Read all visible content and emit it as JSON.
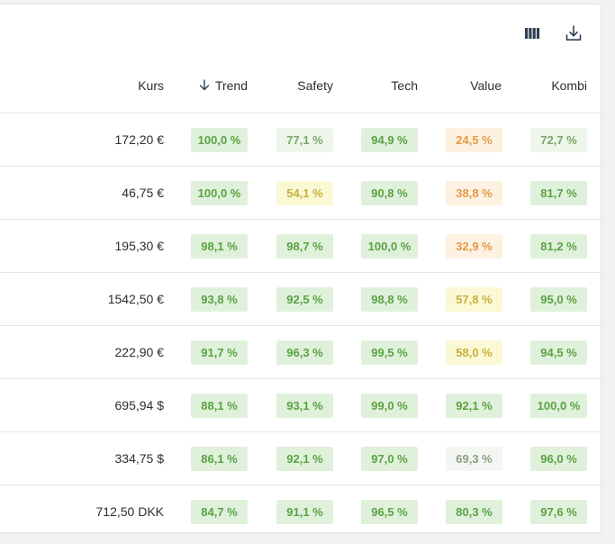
{
  "toolbar": {
    "columns_icon": "columns-icon",
    "download_icon": "download-icon"
  },
  "table": {
    "headers": {
      "kurs": "Kurs",
      "trend": "Trend",
      "safety": "Safety",
      "tech": "Tech",
      "value": "Value",
      "kombi": "Kombi"
    },
    "sort_icon": "arrow-down-icon",
    "rows": [
      {
        "price": "172,20 €",
        "trend": "100,0 %",
        "safety": "77,1 %",
        "tech": "94,9 %",
        "value": "24,5 %",
        "kombi": "72,7 %"
      },
      {
        "price": "46,75 €",
        "trend": "100,0 %",
        "safety": "54,1 %",
        "tech": "90,8 %",
        "value": "38,8 %",
        "kombi": "81,7 %"
      },
      {
        "price": "195,30 €",
        "trend": "98,1 %",
        "safety": "98,7 %",
        "tech": "100,0 %",
        "value": "32,9 %",
        "kombi": "81,2 %"
      },
      {
        "price": "1542,50 €",
        "trend": "93,8 %",
        "safety": "92,5 %",
        "tech": "98,8 %",
        "value": "57,8 %",
        "kombi": "95,0 %"
      },
      {
        "price": "222,90 €",
        "trend": "91,7 %",
        "safety": "96,3 %",
        "tech": "99,5 %",
        "value": "58,0 %",
        "kombi": "94,5 %"
      },
      {
        "price": "695,94 $",
        "trend": "88,1 %",
        "safety": "93,1 %",
        "tech": "99,0 %",
        "value": "92,1 %",
        "kombi": "100,0 %"
      },
      {
        "price": "334,75 $",
        "trend": "86,1 %",
        "safety": "92,1 %",
        "tech": "97,0 %",
        "value": "69,3 %",
        "kombi": "96,0 %"
      },
      {
        "price": "712,50 DKK",
        "trend": "84,7 %",
        "safety": "91,1 %",
        "tech": "96,5 %",
        "value": "80,3 %",
        "kombi": "97,6 %"
      }
    ]
  },
  "colors": {
    "high_bg": "#dff1da",
    "high_text": "#5aa244",
    "mid_bg": "#eef5ea",
    "mid_text": "#7da66c",
    "neutral_bg": "#f4f6f3",
    "neutral_text": "#8aa07f",
    "yellow_bg": "#fbf8d6",
    "yellow_text": "#c7b03c",
    "orange_bg": "#fdf1e1",
    "orange_text": "#e39a45",
    "icon": "#2f3f54"
  }
}
